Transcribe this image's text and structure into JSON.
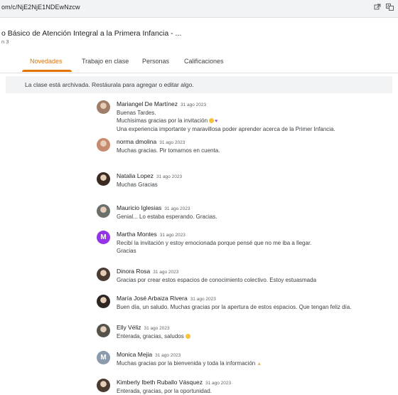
{
  "browser": {
    "url": "om/c/NjE2NjE1NDEwNzcw",
    "icons": [
      "external-link-icon",
      "translate-icon"
    ]
  },
  "course": {
    "title": "o Básico de Atención Integral a la Primera Infancia - ...",
    "section": "n 3"
  },
  "tabs": [
    {
      "label": "Novedades",
      "active": true
    },
    {
      "label": "Trabajo en clase",
      "active": false
    },
    {
      "label": "Personas",
      "active": false
    },
    {
      "label": "Calificaciones",
      "active": false
    }
  ],
  "banner": {
    "text": "La clase está archivada. Restáurala para agregar o editar algo."
  },
  "colors": {
    "accent": "#e37400",
    "avatar_purple": "#9334e6",
    "avatar_gray": "#8a9bad"
  },
  "comments": [
    {
      "author": "Mariangel De Martínez",
      "date": "31 ago 2023",
      "lines": [
        {
          "text": "Buenas Tardes."
        },
        {
          "text": "Muchisimas gracias por la invitación",
          "emoji": "smile-heart"
        },
        {
          "text": "Una experiencia importante y maravillosa poder aprender acerca de la Primer Infancia."
        }
      ],
      "avatar": {
        "type": "photo",
        "color": "#a07d68",
        "icon": "user-photo-icon"
      }
    },
    {
      "author": "norma dmolina",
      "date": "31 ago 2023",
      "lines": [
        {
          "text": "Muchas gracias. Pir tomarnos en cuenta."
        }
      ],
      "avatar": {
        "type": "photo",
        "color": "#c88a6e",
        "icon": "user-photo-icon"
      }
    },
    {
      "author": "Natalia Lopez",
      "date": "31 ago 2023",
      "lines": [
        {
          "text": "Muchas Gracias"
        }
      ],
      "avatar": {
        "type": "photo",
        "color": "#3a2a22",
        "icon": "user-photo-icon"
      }
    },
    {
      "author": "Mauricio Iglesias",
      "date": "31 ago 2023",
      "lines": [
        {
          "text": "Genial... Lo estaba esperando. Gracias."
        }
      ],
      "avatar": {
        "type": "photo",
        "color": "#6b6f6b",
        "icon": "user-photo-icon"
      }
    },
    {
      "author": "Martha Montes",
      "date": "31 ago 2023",
      "lines": [
        {
          "text": "Recibí la invitación y estoy emocionada porque pensé que no me iba a llegar."
        },
        {
          "text": "Gracias"
        }
      ],
      "avatar": {
        "type": "letter",
        "letter": "M",
        "color": "#9334e6",
        "icon": "letter-avatar-icon"
      }
    },
    {
      "author": "Dinora Rosa",
      "date": "31 ago 2023",
      "lines": [
        {
          "text": "Gracias por crear estos espacios de conocimiento colectivo. Estoy estuasmada"
        }
      ],
      "avatar": {
        "type": "photo",
        "color": "#4a3b33",
        "icon": "user-photo-icon"
      }
    },
    {
      "author": "María José Arbaiza Rivera",
      "date": "31 ago 2023",
      "lines": [
        {
          "text": "Buen día, un saludo. Muchas gracias por la apertura de estos espacios. Que tengan feliz día."
        }
      ],
      "avatar": {
        "type": "photo",
        "color": "#2e2622",
        "icon": "user-photo-icon"
      }
    },
    {
      "author": "Elly Véliz",
      "date": "31 ago 2023",
      "lines": [
        {
          "text": "Enterada, gracias, saludos",
          "emoji": "smile"
        }
      ],
      "avatar": {
        "type": "photo",
        "color": "#55514b",
        "icon": "user-photo-icon"
      }
    },
    {
      "author": "Monica Mejia",
      "date": "31 ago 2023",
      "lines": [
        {
          "text": "Muchas gracias por la bienvenida y toda la información",
          "emoji": "thumb"
        }
      ],
      "avatar": {
        "type": "letter",
        "letter": "M",
        "color": "#8a9bad",
        "icon": "letter-avatar-icon"
      }
    },
    {
      "author": "Kimberly Ibeth Ruballo Vásquez",
      "date": "31 ago 2023",
      "lines": [
        {
          "text": "Enterada, gracias, por la oportunidad."
        }
      ],
      "avatar": {
        "type": "photo",
        "color": "#4b3a30",
        "icon": "user-photo-icon"
      }
    }
  ]
}
